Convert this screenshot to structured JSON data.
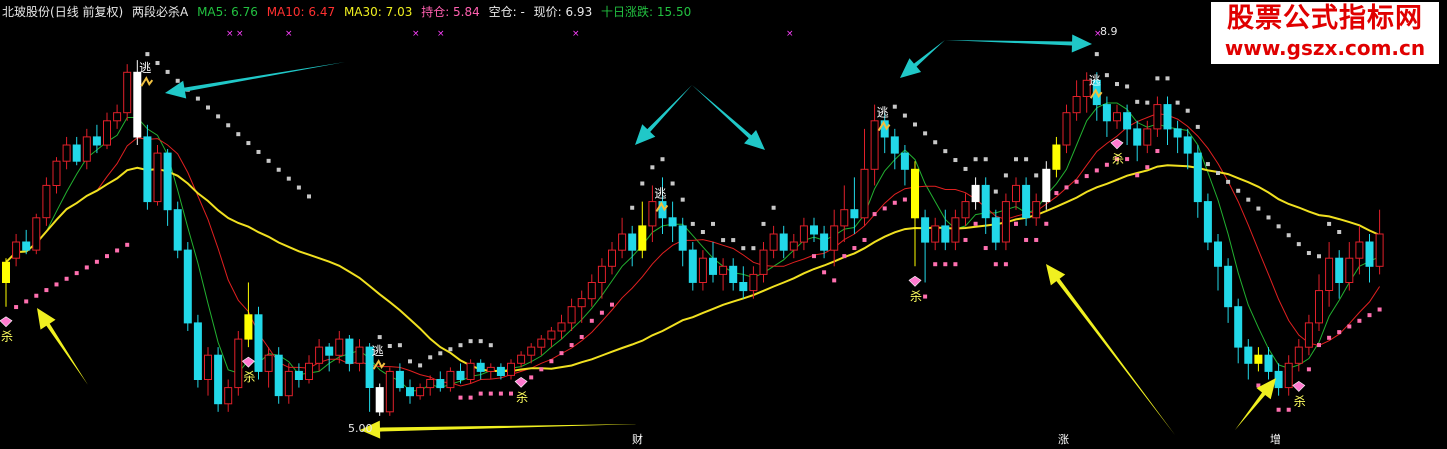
{
  "header": {
    "stock": "北玻股份",
    "mode": "(日线 前复权)",
    "indicator": "两段必杀A",
    "ma5": "MA5: 6.76",
    "ma10": "MA10: 6.47",
    "ma30": "MA30: 7.03",
    "hold": "持仓: 5.84",
    "empty": "空仓: -",
    "price": "现价: 6.93",
    "ten_day": "十日涨跌: 15.50"
  },
  "watermark": {
    "line1": "股票公式指标网",
    "line2": "www.gszx.com.cn"
  },
  "chart_data": {
    "type": "candlestick",
    "signals": {
      "escape": "逃",
      "kill": "杀"
    },
    "price_labels": [
      "8.9",
      "5.00"
    ],
    "event_markers": [
      "财",
      "涨",
      "增"
    ],
    "colors": {
      "up": "#e0202a",
      "down": "#22d8e8",
      "hold_bar": "#ffff00",
      "special": "#ffffff",
      "ma5": "#22b030",
      "ma10": "#e02020",
      "ma30": "#f0e020",
      "upper_dots": "#c8c8c8",
      "lower_dots": "#ff70b0",
      "arrow_cyan": "#20c8c8",
      "arrow_yellow": "#f0f020"
    },
    "ohlc": [
      [
        6.6,
        6.85,
        6.3,
        6.9
      ],
      [
        6.9,
        7.1,
        6.8,
        7.2
      ],
      [
        7.1,
        7.0,
        6.95,
        7.25
      ],
      [
        7.0,
        7.4,
        6.95,
        7.45
      ],
      [
        7.4,
        7.8,
        7.3,
        7.9
      ],
      [
        7.8,
        8.1,
        7.7,
        8.15
      ],
      [
        8.1,
        8.3,
        8.0,
        8.4
      ],
      [
        8.3,
        8.1,
        8.05,
        8.4
      ],
      [
        8.1,
        8.4,
        8.0,
        8.5
      ],
      [
        8.4,
        8.3,
        8.2,
        8.55
      ],
      [
        8.3,
        8.6,
        8.25,
        8.7
      ],
      [
        8.6,
        8.7,
        8.5,
        8.8
      ],
      [
        8.7,
        9.2,
        8.6,
        9.3
      ],
      [
        9.2,
        8.4,
        8.3,
        9.35
      ],
      [
        8.4,
        7.6,
        7.5,
        8.55
      ],
      [
        7.6,
        8.2,
        7.55,
        8.3
      ],
      [
        8.2,
        7.5,
        7.3,
        8.25
      ],
      [
        7.5,
        7.0,
        6.9,
        7.6
      ],
      [
        7.0,
        6.1,
        6.0,
        7.1
      ],
      [
        6.1,
        5.4,
        5.3,
        6.2
      ],
      [
        5.4,
        5.7,
        5.2,
        5.8
      ],
      [
        5.7,
        5.1,
        5.0,
        5.8
      ],
      [
        5.1,
        5.3,
        5.0,
        5.4
      ],
      [
        5.3,
        5.9,
        5.2,
        6.0
      ],
      [
        5.9,
        6.2,
        5.8,
        6.6
      ],
      [
        6.2,
        5.5,
        5.4,
        6.3
      ],
      [
        5.5,
        5.7,
        5.3,
        5.8
      ],
      [
        5.7,
        5.2,
        5.1,
        5.8
      ],
      [
        5.2,
        5.5,
        5.1,
        5.6
      ],
      [
        5.5,
        5.4,
        5.3,
        5.6
      ],
      [
        5.4,
        5.6,
        5.35,
        5.7
      ],
      [
        5.6,
        5.8,
        5.5,
        5.9
      ],
      [
        5.8,
        5.7,
        5.5,
        5.85
      ],
      [
        5.7,
        5.9,
        5.6,
        6.0
      ],
      [
        5.9,
        5.6,
        5.5,
        5.95
      ],
      [
        5.6,
        5.8,
        5.5,
        5.9
      ],
      [
        5.8,
        5.3,
        5.0,
        5.85
      ],
      [
        5.3,
        5.0,
        4.95,
        5.35
      ],
      [
        5.0,
        5.5,
        4.95,
        5.55
      ],
      [
        5.5,
        5.3,
        5.25,
        5.6
      ],
      [
        5.3,
        5.2,
        5.1,
        5.4
      ],
      [
        5.2,
        5.3,
        5.15,
        5.35
      ],
      [
        5.3,
        5.4,
        5.2,
        5.45
      ],
      [
        5.4,
        5.3,
        5.25,
        5.5
      ],
      [
        5.3,
        5.5,
        5.25,
        5.55
      ],
      [
        5.5,
        5.4,
        5.35,
        5.6
      ],
      [
        5.4,
        5.6,
        5.35,
        5.65
      ],
      [
        5.6,
        5.5,
        5.4,
        5.65
      ],
      [
        5.5,
        5.55,
        5.4,
        5.6
      ],
      [
        5.55,
        5.45,
        5.4,
        5.6
      ],
      [
        5.45,
        5.6,
        5.4,
        5.65
      ],
      [
        5.6,
        5.7,
        5.55,
        5.75
      ],
      [
        5.7,
        5.8,
        5.6,
        5.85
      ],
      [
        5.8,
        5.9,
        5.7,
        5.95
      ],
      [
        5.9,
        6.0,
        5.8,
        6.05
      ],
      [
        6.0,
        6.1,
        5.9,
        6.2
      ],
      [
        6.1,
        6.3,
        6.0,
        6.4
      ],
      [
        6.3,
        6.4,
        6.1,
        6.5
      ],
      [
        6.4,
        6.6,
        6.3,
        6.7
      ],
      [
        6.6,
        6.8,
        6.4,
        6.9
      ],
      [
        6.8,
        7.0,
        6.7,
        7.1
      ],
      [
        7.0,
        7.2,
        6.9,
        7.4
      ],
      [
        7.2,
        7.0,
        6.8,
        7.3
      ],
      [
        7.0,
        7.3,
        6.9,
        7.6
      ],
      [
        7.3,
        7.6,
        7.1,
        7.8
      ],
      [
        7.6,
        7.4,
        7.2,
        7.9
      ],
      [
        7.4,
        7.3,
        7.1,
        7.6
      ],
      [
        7.3,
        7.0,
        6.8,
        7.4
      ],
      [
        7.0,
        6.6,
        6.5,
        7.1
      ],
      [
        6.6,
        6.9,
        6.5,
        7.0
      ],
      [
        6.9,
        6.7,
        6.6,
        7.1
      ],
      [
        6.7,
        6.8,
        6.5,
        6.9
      ],
      [
        6.8,
        6.6,
        6.5,
        6.9
      ],
      [
        6.6,
        6.5,
        6.4,
        6.8
      ],
      [
        6.5,
        6.7,
        6.4,
        6.8
      ],
      [
        6.7,
        7.0,
        6.6,
        7.1
      ],
      [
        7.0,
        7.2,
        6.9,
        7.3
      ],
      [
        7.2,
        7.0,
        6.9,
        7.3
      ],
      [
        7.0,
        7.1,
        6.9,
        7.2
      ],
      [
        7.1,
        7.3,
        7.0,
        7.4
      ],
      [
        7.3,
        7.2,
        7.1,
        7.4
      ],
      [
        7.2,
        7.0,
        6.9,
        7.3
      ],
      [
        7.0,
        7.3,
        6.8,
        7.5
      ],
      [
        7.3,
        7.5,
        7.1,
        7.8
      ],
      [
        7.5,
        7.4,
        7.2,
        7.9
      ],
      [
        7.4,
        8.0,
        7.3,
        8.5
      ],
      [
        8.0,
        8.6,
        7.8,
        8.8
      ],
      [
        8.6,
        8.4,
        8.2,
        8.7
      ],
      [
        8.4,
        8.2,
        8.0,
        8.5
      ],
      [
        8.2,
        8.0,
        7.8,
        8.3
      ],
      [
        8.0,
        7.4,
        6.8,
        8.1
      ],
      [
        7.4,
        7.1,
        6.6,
        7.5
      ],
      [
        7.1,
        7.3,
        7.0,
        7.4
      ],
      [
        7.3,
        7.1,
        7.0,
        7.5
      ],
      [
        7.1,
        7.4,
        7.0,
        7.5
      ],
      [
        7.4,
        7.6,
        7.3,
        7.7
      ],
      [
        7.6,
        7.8,
        7.5,
        7.9
      ],
      [
        7.8,
        7.4,
        7.2,
        7.9
      ],
      [
        7.4,
        7.1,
        7.0,
        7.5
      ],
      [
        7.1,
        7.6,
        7.0,
        7.7
      ],
      [
        7.6,
        7.8,
        7.5,
        7.9
      ],
      [
        7.8,
        7.4,
        7.3,
        7.9
      ],
      [
        7.4,
        7.6,
        7.3,
        7.7
      ],
      [
        7.6,
        8.0,
        7.5,
        8.1
      ],
      [
        8.0,
        8.3,
        7.9,
        8.4
      ],
      [
        8.3,
        8.7,
        8.2,
        8.8
      ],
      [
        8.7,
        8.9,
        8.6,
        9.1
      ],
      [
        8.9,
        9.1,
        8.7,
        9.2
      ],
      [
        9.1,
        8.8,
        8.6,
        9.2
      ],
      [
        8.8,
        8.6,
        8.4,
        8.9
      ],
      [
        8.6,
        8.7,
        8.5,
        8.8
      ],
      [
        8.7,
        8.5,
        8.3,
        8.8
      ],
      [
        8.5,
        8.3,
        8.1,
        8.6
      ],
      [
        8.3,
        8.5,
        8.2,
        8.6
      ],
      [
        8.5,
        8.8,
        8.4,
        8.9
      ],
      [
        8.8,
        8.5,
        8.3,
        8.9
      ],
      [
        8.5,
        8.4,
        8.2,
        8.6
      ],
      [
        8.4,
        8.2,
        8.0,
        8.5
      ],
      [
        8.2,
        7.6,
        7.4,
        8.3
      ],
      [
        7.6,
        7.1,
        7.0,
        7.7
      ],
      [
        7.1,
        6.8,
        6.5,
        7.2
      ],
      [
        6.8,
        6.3,
        6.1,
        6.9
      ],
      [
        6.3,
        5.8,
        5.6,
        6.4
      ],
      [
        5.8,
        5.6,
        5.4,
        5.9
      ],
      [
        5.6,
        5.7,
        5.5,
        5.8
      ],
      [
        5.7,
        5.5,
        5.4,
        5.8
      ],
      [
        5.5,
        5.3,
        5.2,
        5.6
      ],
      [
        5.3,
        5.6,
        5.2,
        5.7
      ],
      [
        5.6,
        5.8,
        5.5,
        5.9
      ],
      [
        5.8,
        6.1,
        5.7,
        6.2
      ],
      [
        6.1,
        6.5,
        6.0,
        6.7
      ],
      [
        6.5,
        6.9,
        6.3,
        7.1
      ],
      [
        6.9,
        6.6,
        6.4,
        7.0
      ],
      [
        6.6,
        6.9,
        6.5,
        7.1
      ],
      [
        6.9,
        7.1,
        6.7,
        7.3
      ],
      [
        7.1,
        6.8,
        6.6,
        7.2
      ],
      [
        6.8,
        7.2,
        6.7,
        7.5
      ]
    ],
    "markers": {
      "escape": [
        13,
        36,
        64,
        86,
        107
      ],
      "kill": [
        0,
        24,
        51,
        90,
        110,
        128
      ],
      "yellow_bars": [
        0,
        24,
        37,
        63,
        90,
        104,
        124
      ],
      "white_bars": [
        13,
        37,
        96,
        103
      ]
    }
  }
}
